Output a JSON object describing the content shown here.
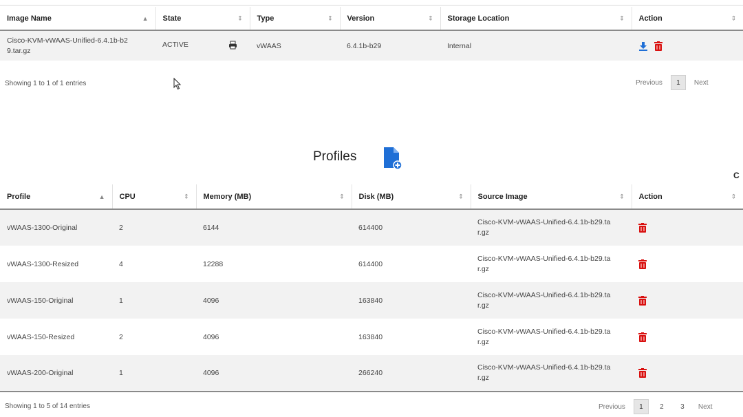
{
  "images_table": {
    "columns": [
      "Image Name",
      "State",
      "Type",
      "Version",
      "Storage Location",
      "Action"
    ],
    "rows": [
      {
        "image_name": "Cisco-KVM-vWAAS-Unified-6.4.1b-b29.tar.gz",
        "image_name_line1": "Cisco-KVM-vWAAS-Unified-6.4.1b-b2",
        "image_name_line2": "9.tar.gz",
        "state": "ACTIVE",
        "type": "vWAAS",
        "version": "6.4.1b-b29",
        "storage_location": "Internal"
      }
    ],
    "info": "Showing 1 to 1 of 1 entries",
    "pager": {
      "previous": "Previous",
      "pages": [
        "1"
      ],
      "next": "Next",
      "active": "1"
    }
  },
  "profiles": {
    "title": "Profiles",
    "add_icon": "file-add-icon",
    "refresh_icon": "refresh-icon",
    "columns": [
      "Profile",
      "CPU",
      "Memory (MB)",
      "Disk (MB)",
      "Source Image",
      "Action"
    ],
    "rows": [
      {
        "profile": "vWAAS-1300-Original",
        "cpu": "2",
        "memory": "6144",
        "disk": "614400",
        "src1": "Cisco-KVM-vWAAS-Unified-6.4.1b-b29.ta",
        "src2": "r.gz"
      },
      {
        "profile": "vWAAS-1300-Resized",
        "cpu": "4",
        "memory": "12288",
        "disk": "614400",
        "src1": "Cisco-KVM-vWAAS-Unified-6.4.1b-b29.ta",
        "src2": "r.gz"
      },
      {
        "profile": "vWAAS-150-Original",
        "cpu": "1",
        "memory": "4096",
        "disk": "163840",
        "src1": "Cisco-KVM-vWAAS-Unified-6.4.1b-b29.ta",
        "src2": "r.gz"
      },
      {
        "profile": "vWAAS-150-Resized",
        "cpu": "2",
        "memory": "4096",
        "disk": "163840",
        "src1": "Cisco-KVM-vWAAS-Unified-6.4.1b-b29.ta",
        "src2": "r.gz"
      },
      {
        "profile": "vWAAS-200-Original",
        "cpu": "1",
        "memory": "4096",
        "disk": "266240",
        "src1": "Cisco-KVM-vWAAS-Unified-6.4.1b-b29.ta",
        "src2": "r.gz"
      }
    ],
    "info": "Showing 1 to 5 of 14 entries",
    "pager": {
      "previous": "Previous",
      "pages": [
        "1",
        "2",
        "3"
      ],
      "next": "Next",
      "active": "1"
    }
  },
  "colors": {
    "delete": "#d9100f",
    "download": "#1f6fd6",
    "file_add": "#1f6fd6"
  }
}
